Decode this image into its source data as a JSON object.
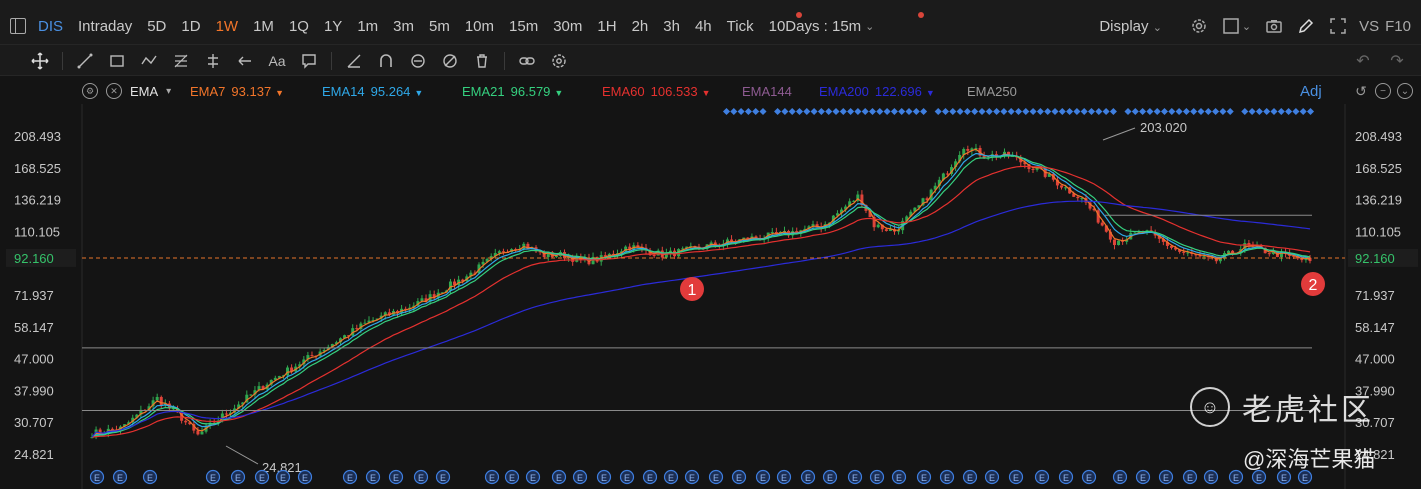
{
  "topbar": {
    "symbol": "DIS",
    "timeframes": [
      "Intraday",
      "5D",
      "1D",
      "1W",
      "1M",
      "1Q",
      "1Y",
      "1m",
      "3m",
      "5m",
      "10m",
      "15m",
      "30m",
      "1H",
      "2h",
      "3h",
      "4h",
      "Tick"
    ],
    "active": "1W",
    "interval": "10Days : 15m",
    "display": "Display",
    "vs": "VS",
    "f10": "F10"
  },
  "indicators": {
    "name": "EMA",
    "lines": [
      {
        "label": "EMA7",
        "value": "93.137",
        "color": "#f2752a",
        "down": true
      },
      {
        "label": "EMA14",
        "value": "95.264",
        "color": "#2fa8e8",
        "down": true
      },
      {
        "label": "EMA21",
        "value": "96.579",
        "color": "#35d07f",
        "down": true
      },
      {
        "label": "EMA60",
        "value": "106.533",
        "color": "#e5312f",
        "down": true
      },
      {
        "label": "EMA144",
        "value": "",
        "color": "#8e5b92",
        "down": false
      },
      {
        "label": "EMA200",
        "value": "122.696",
        "color": "#2b2bd9",
        "down": true
      },
      {
        "label": "EMA250",
        "value": "",
        "color": "#9a9a9a",
        "down": false
      }
    ],
    "adj": "Adj"
  },
  "chart_data": {
    "type": "candlestick",
    "scale": "log",
    "ylim": [
      22,
      240
    ],
    "y_ticks": [
      "208.493",
      "168.525",
      "136.219",
      "110.105",
      "92.160",
      "71.937",
      "58.147",
      "47.000",
      "37.990",
      "30.707",
      "24.821"
    ],
    "last_price": "92.160",
    "annotations": {
      "high": "203.020",
      "low": "24.821"
    },
    "markers": [
      "1",
      "2"
    ],
    "colors": {
      "up": "#2fa84f",
      "down": "#e0443a",
      "price_line": "#e6732a"
    }
  },
  "watermark": {
    "logo": "☺",
    "text": "老虎社区",
    "author": "@深海芒果猫"
  }
}
